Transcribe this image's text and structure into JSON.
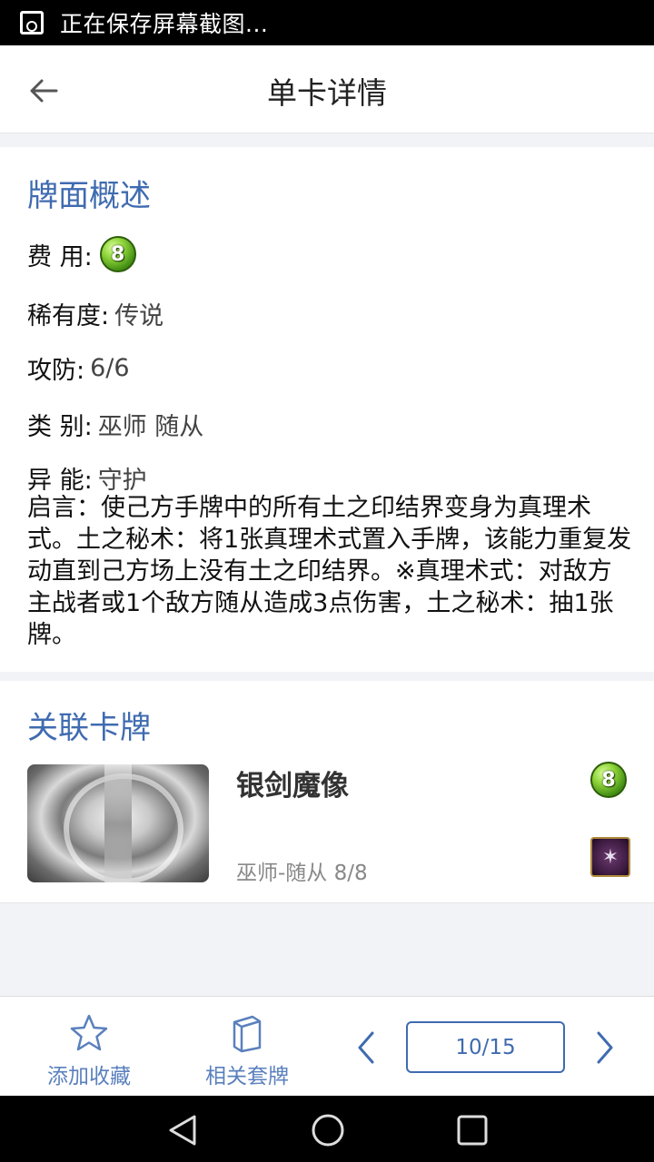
{
  "status_bar": {
    "text": "正在保存屏幕截图..."
  },
  "header": {
    "title": "单卡详情"
  },
  "overview": {
    "section_title": "牌面概述",
    "cost_label": "费 用:",
    "cost_value": "8",
    "rarity_label": "稀有度:",
    "rarity_value": "传说",
    "stats_label": "攻防:",
    "stats_value": "6/6",
    "type_label": "类 别:",
    "type_value": "巫师 随从",
    "ability_label": "异 能:",
    "ability_value": "守护",
    "ability_text": "启言：使己方手牌中的所有土之印结界变身为真理术式。土之秘术：将1张真理术式置入手牌，该能力重复发动直到己方场上没有土之印结界。※真理术式：对敌方主战者或1个敌方随从造成3点伤害，土之秘术：抽1张牌。"
  },
  "related": {
    "section_title": "关联卡牌",
    "cards": [
      {
        "name": "银剑魔像",
        "subtitle": "巫师-随从  8/8",
        "cost": "8"
      }
    ]
  },
  "toolbar": {
    "favorite_label": "添加收藏",
    "decks_label": "相关套牌",
    "page_indicator": "10/15"
  },
  "colors": {
    "accent": "#3f6bb0",
    "cost_gem": "#6fbf2a"
  }
}
